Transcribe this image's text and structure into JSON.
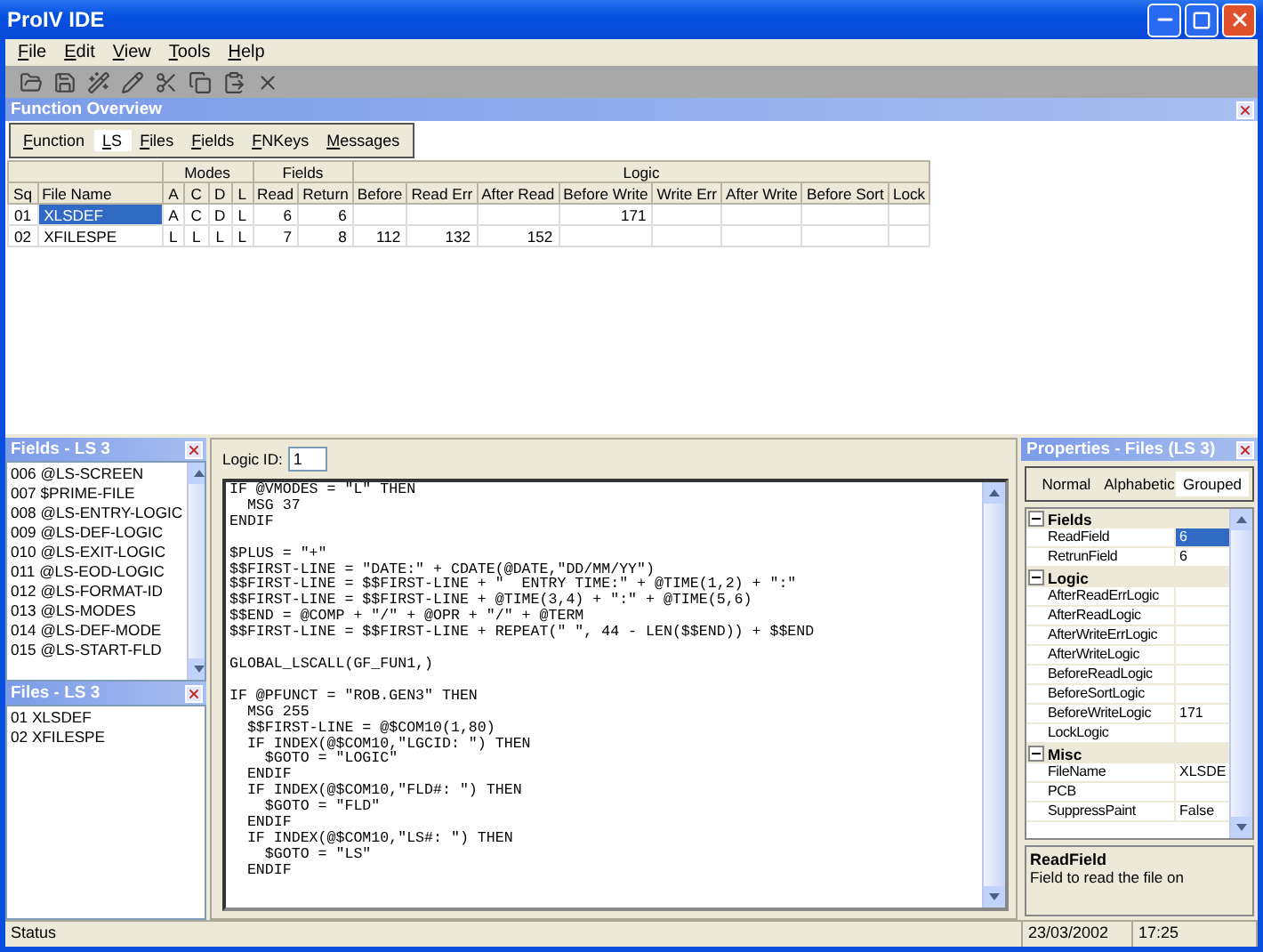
{
  "window": {
    "title": "ProIV IDE"
  },
  "menu": [
    "File",
    "Edit",
    "View",
    "Tools",
    "Help"
  ],
  "overview": {
    "title": "Function Overview",
    "tabs": [
      {
        "label": "Function",
        "selected": false
      },
      {
        "label": "LS",
        "selected": true
      },
      {
        "label": "Files",
        "selected": false
      },
      {
        "label": "Fields",
        "selected": false
      },
      {
        "label": "FNKeys",
        "selected": false
      },
      {
        "label": "Messages",
        "selected": false
      }
    ],
    "key_columns": [
      "Sq",
      "File Name"
    ],
    "groups": [
      {
        "label": "Modes",
        "columns": [
          "A",
          "C",
          "D",
          "L"
        ]
      },
      {
        "label": "Fields",
        "columns": [
          "Read",
          "Return"
        ]
      },
      {
        "label": "Logic",
        "columns": [
          "Before",
          "Read Err",
          "After Read",
          "Before Write",
          "Write Err",
          "After Write",
          "Before Sort",
          "Lock"
        ]
      }
    ],
    "rows": [
      {
        "selected": true,
        "cells": [
          "01",
          "XLSDEF",
          "A",
          "C",
          "D",
          "L",
          "6",
          "6",
          "",
          "",
          "",
          "171",
          "",
          "",
          "",
          ""
        ]
      },
      {
        "selected": false,
        "cells": [
          "02",
          "XFILESPE",
          "L",
          "L",
          "L",
          "L",
          "7",
          "8",
          "112",
          "132",
          "152",
          "",
          "",
          "",
          "",
          ""
        ]
      }
    ]
  },
  "fields_panel": {
    "title": "Fields - LS 3",
    "items": [
      "006 @LS-SCREEN",
      "007 $PRIME-FILE",
      "008 @LS-ENTRY-LOGIC",
      "009 @LS-DEF-LOGIC",
      "010 @LS-EXIT-LOGIC",
      "011 @LS-EOD-LOGIC",
      "012 @LS-FORMAT-ID",
      "013 @LS-MODES",
      "014 @LS-DEF-MODE",
      "015 @LS-START-FLD"
    ]
  },
  "files_panel": {
    "title": "Files - LS 3",
    "items": [
      "01 XLSDEF",
      "02 XFILESPE"
    ]
  },
  "editor": {
    "logic_id_label": "Logic ID:",
    "logic_id": "1",
    "code": "IF @VMODES = \"L\" THEN\n  MSG 37\nENDIF\n\n$PLUS = \"+\"\n$$FIRST-LINE = \"DATE:\" + CDATE(@DATE,\"DD/MM/YY\")\n$$FIRST-LINE = $$FIRST-LINE + \"  ENTRY TIME:\" + @TIME(1,2) + \":\"\n$$FIRST-LINE = $$FIRST-LINE + @TIME(3,4) + \":\" + @TIME(5,6)\n$$END = @COMP + \"/\" + @OPR + \"/\" + @TERM\n$$FIRST-LINE = $$FIRST-LINE + REPEAT(\" \", 44 - LEN($$END)) + $$END\n\nGLOBAL_LSCALL(GF_FUN1,)\n\nIF @PFUNCT = \"ROB.GEN3\" THEN\n  MSG 255\n  $$FIRST-LINE = @$COM10(1,80)\n  IF INDEX(@$COM10,\"LGCID: \") THEN\n    $GOTO = \"LOGIC\"\n  ENDIF\n  IF INDEX(@$COM10,\"FLD#: \") THEN\n    $GOTO = \"FLD\"\n  ENDIF\n  IF INDEX(@$COM10,\"LS#: \") THEN\n    $GOTO = \"LS\"\n  ENDIF"
  },
  "properties": {
    "title": "Properties - Files (LS 3)",
    "tabs": [
      {
        "label": "Normal",
        "selected": false
      },
      {
        "label": "Alphabetic",
        "selected": false
      },
      {
        "label": "Grouped",
        "selected": true
      }
    ],
    "groups": [
      {
        "label": "Fields",
        "expanded": true,
        "items": [
          {
            "name": "ReadField",
            "value": "6",
            "selected": true
          },
          {
            "name": "RetrunField",
            "value": "6",
            "selected": false
          }
        ]
      },
      {
        "label": "Logic",
        "expanded": true,
        "items": [
          {
            "name": "AfterReadErrLogic",
            "selected": false
          },
          {
            "name": "AfterReadLogic",
            "selected": false
          },
          {
            "name": "AfterWriteErrLogic",
            "selected": false
          },
          {
            "name": "AfterWriteLogic",
            "selected": false
          },
          {
            "name": "BeforeReadLogic",
            "selected": false
          },
          {
            "name": "BeforeSortLogic",
            "selected": false
          },
          {
            "name": "BeforeWriteLogic",
            "value": "171",
            "selected": false
          },
          {
            "name": "LockLogic",
            "selected": false
          }
        ]
      },
      {
        "label": "Misc",
        "expanded": true,
        "items": [
          {
            "name": "FileName",
            "value": "XLSDE",
            "selected": false
          },
          {
            "name": "PCB",
            "selected": false
          },
          {
            "name": "SuppressPaint",
            "value": "False",
            "selected": false
          }
        ]
      }
    ],
    "help_title": "ReadField",
    "help_text": "Field to read the file on"
  },
  "status_bar": [
    "Status",
    "23/03/2002",
    "17:25"
  ]
}
